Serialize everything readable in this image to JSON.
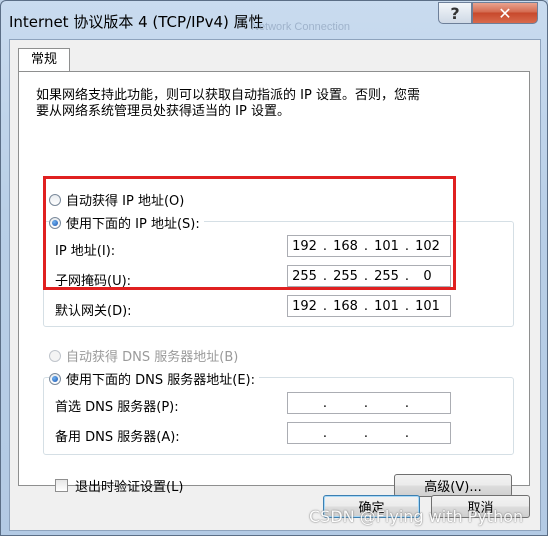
{
  "window": {
    "title": "Internet 协议版本 4 (TCP/IPv4) 属性",
    "background_ghost_text": "Network Connection",
    "help_label": "?",
    "close_label": "✕"
  },
  "tab": {
    "label": "常规"
  },
  "description": "如果网络支持此功能，则可以获取自动指派的 IP 设置。否则，您需\n要从网络系统管理员处获得适当的 IP 设置。",
  "ip": {
    "auto_label": "自动获得 IP 地址(O)",
    "manual_label": "使用下面的 IP 地址(S):",
    "selected": "manual",
    "address_label": "IP 地址(I):",
    "address": [
      "192",
      "168",
      "101",
      "102"
    ],
    "mask_label": "子网掩码(U):",
    "mask": [
      "255",
      "255",
      "255",
      "0"
    ],
    "gateway_label": "默认网关(D):",
    "gateway": [
      "192",
      "168",
      "101",
      "101"
    ]
  },
  "dns": {
    "auto_label": "自动获得 DNS 服务器地址(B)",
    "auto_enabled": false,
    "manual_label": "使用下面的 DNS 服务器地址(E):",
    "selected": "manual",
    "preferred_label": "首选 DNS 服务器(P):",
    "preferred": [
      "",
      "",
      "",
      ""
    ],
    "alternate_label": "备用 DNS 服务器(A):",
    "alternate": [
      "",
      "",
      "",
      ""
    ]
  },
  "validate": {
    "label": "退出时验证设置(L)",
    "checked": false
  },
  "advanced_button": "高级(V)...",
  "ok_button": "确定",
  "cancel_button": "取消",
  "watermark": "CSDN @Flying with Python",
  "colors": {
    "highlight_box": "#e02020",
    "close_button": "#c7492c",
    "disabled_text": "#9a9a9a"
  }
}
